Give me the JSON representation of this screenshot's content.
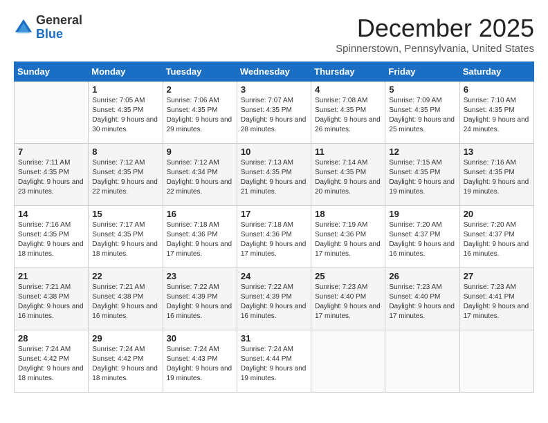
{
  "header": {
    "logo_general": "General",
    "logo_blue": "Blue",
    "month_title": "December 2025",
    "location": "Spinnerstown, Pennsylvania, United States"
  },
  "days_of_week": [
    "Sunday",
    "Monday",
    "Tuesday",
    "Wednesday",
    "Thursday",
    "Friday",
    "Saturday"
  ],
  "weeks": [
    [
      {
        "day": "",
        "sunrise": "",
        "sunset": "",
        "daylight": ""
      },
      {
        "day": "1",
        "sunrise": "Sunrise: 7:05 AM",
        "sunset": "Sunset: 4:35 PM",
        "daylight": "Daylight: 9 hours and 30 minutes."
      },
      {
        "day": "2",
        "sunrise": "Sunrise: 7:06 AM",
        "sunset": "Sunset: 4:35 PM",
        "daylight": "Daylight: 9 hours and 29 minutes."
      },
      {
        "day": "3",
        "sunrise": "Sunrise: 7:07 AM",
        "sunset": "Sunset: 4:35 PM",
        "daylight": "Daylight: 9 hours and 28 minutes."
      },
      {
        "day": "4",
        "sunrise": "Sunrise: 7:08 AM",
        "sunset": "Sunset: 4:35 PM",
        "daylight": "Daylight: 9 hours and 26 minutes."
      },
      {
        "day": "5",
        "sunrise": "Sunrise: 7:09 AM",
        "sunset": "Sunset: 4:35 PM",
        "daylight": "Daylight: 9 hours and 25 minutes."
      },
      {
        "day": "6",
        "sunrise": "Sunrise: 7:10 AM",
        "sunset": "Sunset: 4:35 PM",
        "daylight": "Daylight: 9 hours and 24 minutes."
      }
    ],
    [
      {
        "day": "7",
        "sunrise": "Sunrise: 7:11 AM",
        "sunset": "Sunset: 4:35 PM",
        "daylight": "Daylight: 9 hours and 23 minutes."
      },
      {
        "day": "8",
        "sunrise": "Sunrise: 7:12 AM",
        "sunset": "Sunset: 4:35 PM",
        "daylight": "Daylight: 9 hours and 22 minutes."
      },
      {
        "day": "9",
        "sunrise": "Sunrise: 7:12 AM",
        "sunset": "Sunset: 4:34 PM",
        "daylight": "Daylight: 9 hours and 22 minutes."
      },
      {
        "day": "10",
        "sunrise": "Sunrise: 7:13 AM",
        "sunset": "Sunset: 4:35 PM",
        "daylight": "Daylight: 9 hours and 21 minutes."
      },
      {
        "day": "11",
        "sunrise": "Sunrise: 7:14 AM",
        "sunset": "Sunset: 4:35 PM",
        "daylight": "Daylight: 9 hours and 20 minutes."
      },
      {
        "day": "12",
        "sunrise": "Sunrise: 7:15 AM",
        "sunset": "Sunset: 4:35 PM",
        "daylight": "Daylight: 9 hours and 19 minutes."
      },
      {
        "day": "13",
        "sunrise": "Sunrise: 7:16 AM",
        "sunset": "Sunset: 4:35 PM",
        "daylight": "Daylight: 9 hours and 19 minutes."
      }
    ],
    [
      {
        "day": "14",
        "sunrise": "Sunrise: 7:16 AM",
        "sunset": "Sunset: 4:35 PM",
        "daylight": "Daylight: 9 hours and 18 minutes."
      },
      {
        "day": "15",
        "sunrise": "Sunrise: 7:17 AM",
        "sunset": "Sunset: 4:35 PM",
        "daylight": "Daylight: 9 hours and 18 minutes."
      },
      {
        "day": "16",
        "sunrise": "Sunrise: 7:18 AM",
        "sunset": "Sunset: 4:36 PM",
        "daylight": "Daylight: 9 hours and 17 minutes."
      },
      {
        "day": "17",
        "sunrise": "Sunrise: 7:18 AM",
        "sunset": "Sunset: 4:36 PM",
        "daylight": "Daylight: 9 hours and 17 minutes."
      },
      {
        "day": "18",
        "sunrise": "Sunrise: 7:19 AM",
        "sunset": "Sunset: 4:36 PM",
        "daylight": "Daylight: 9 hours and 17 minutes."
      },
      {
        "day": "19",
        "sunrise": "Sunrise: 7:20 AM",
        "sunset": "Sunset: 4:37 PM",
        "daylight": "Daylight: 9 hours and 16 minutes."
      },
      {
        "day": "20",
        "sunrise": "Sunrise: 7:20 AM",
        "sunset": "Sunset: 4:37 PM",
        "daylight": "Daylight: 9 hours and 16 minutes."
      }
    ],
    [
      {
        "day": "21",
        "sunrise": "Sunrise: 7:21 AM",
        "sunset": "Sunset: 4:38 PM",
        "daylight": "Daylight: 9 hours and 16 minutes."
      },
      {
        "day": "22",
        "sunrise": "Sunrise: 7:21 AM",
        "sunset": "Sunset: 4:38 PM",
        "daylight": "Daylight: 9 hours and 16 minutes."
      },
      {
        "day": "23",
        "sunrise": "Sunrise: 7:22 AM",
        "sunset": "Sunset: 4:39 PM",
        "daylight": "Daylight: 9 hours and 16 minutes."
      },
      {
        "day": "24",
        "sunrise": "Sunrise: 7:22 AM",
        "sunset": "Sunset: 4:39 PM",
        "daylight": "Daylight: 9 hours and 16 minutes."
      },
      {
        "day": "25",
        "sunrise": "Sunrise: 7:23 AM",
        "sunset": "Sunset: 4:40 PM",
        "daylight": "Daylight: 9 hours and 17 minutes."
      },
      {
        "day": "26",
        "sunrise": "Sunrise: 7:23 AM",
        "sunset": "Sunset: 4:40 PM",
        "daylight": "Daylight: 9 hours and 17 minutes."
      },
      {
        "day": "27",
        "sunrise": "Sunrise: 7:23 AM",
        "sunset": "Sunset: 4:41 PM",
        "daylight": "Daylight: 9 hours and 17 minutes."
      }
    ],
    [
      {
        "day": "28",
        "sunrise": "Sunrise: 7:24 AM",
        "sunset": "Sunset: 4:42 PM",
        "daylight": "Daylight: 9 hours and 18 minutes."
      },
      {
        "day": "29",
        "sunrise": "Sunrise: 7:24 AM",
        "sunset": "Sunset: 4:42 PM",
        "daylight": "Daylight: 9 hours and 18 minutes."
      },
      {
        "day": "30",
        "sunrise": "Sunrise: 7:24 AM",
        "sunset": "Sunset: 4:43 PM",
        "daylight": "Daylight: 9 hours and 19 minutes."
      },
      {
        "day": "31",
        "sunrise": "Sunrise: 7:24 AM",
        "sunset": "Sunset: 4:44 PM",
        "daylight": "Daylight: 9 hours and 19 minutes."
      },
      {
        "day": "",
        "sunrise": "",
        "sunset": "",
        "daylight": ""
      },
      {
        "day": "",
        "sunrise": "",
        "sunset": "",
        "daylight": ""
      },
      {
        "day": "",
        "sunrise": "",
        "sunset": "",
        "daylight": ""
      }
    ]
  ]
}
